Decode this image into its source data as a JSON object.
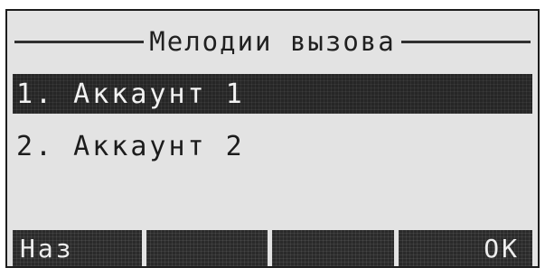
{
  "screen": {
    "title": "Мелодии вызова",
    "items": [
      {
        "label": "1. Аккаунт 1",
        "selected": true
      },
      {
        "label": "2. Аккаунт 2",
        "selected": false
      }
    ],
    "softkeys": {
      "left": "Наз",
      "mid1": "",
      "mid2": "",
      "right": "OK"
    }
  }
}
